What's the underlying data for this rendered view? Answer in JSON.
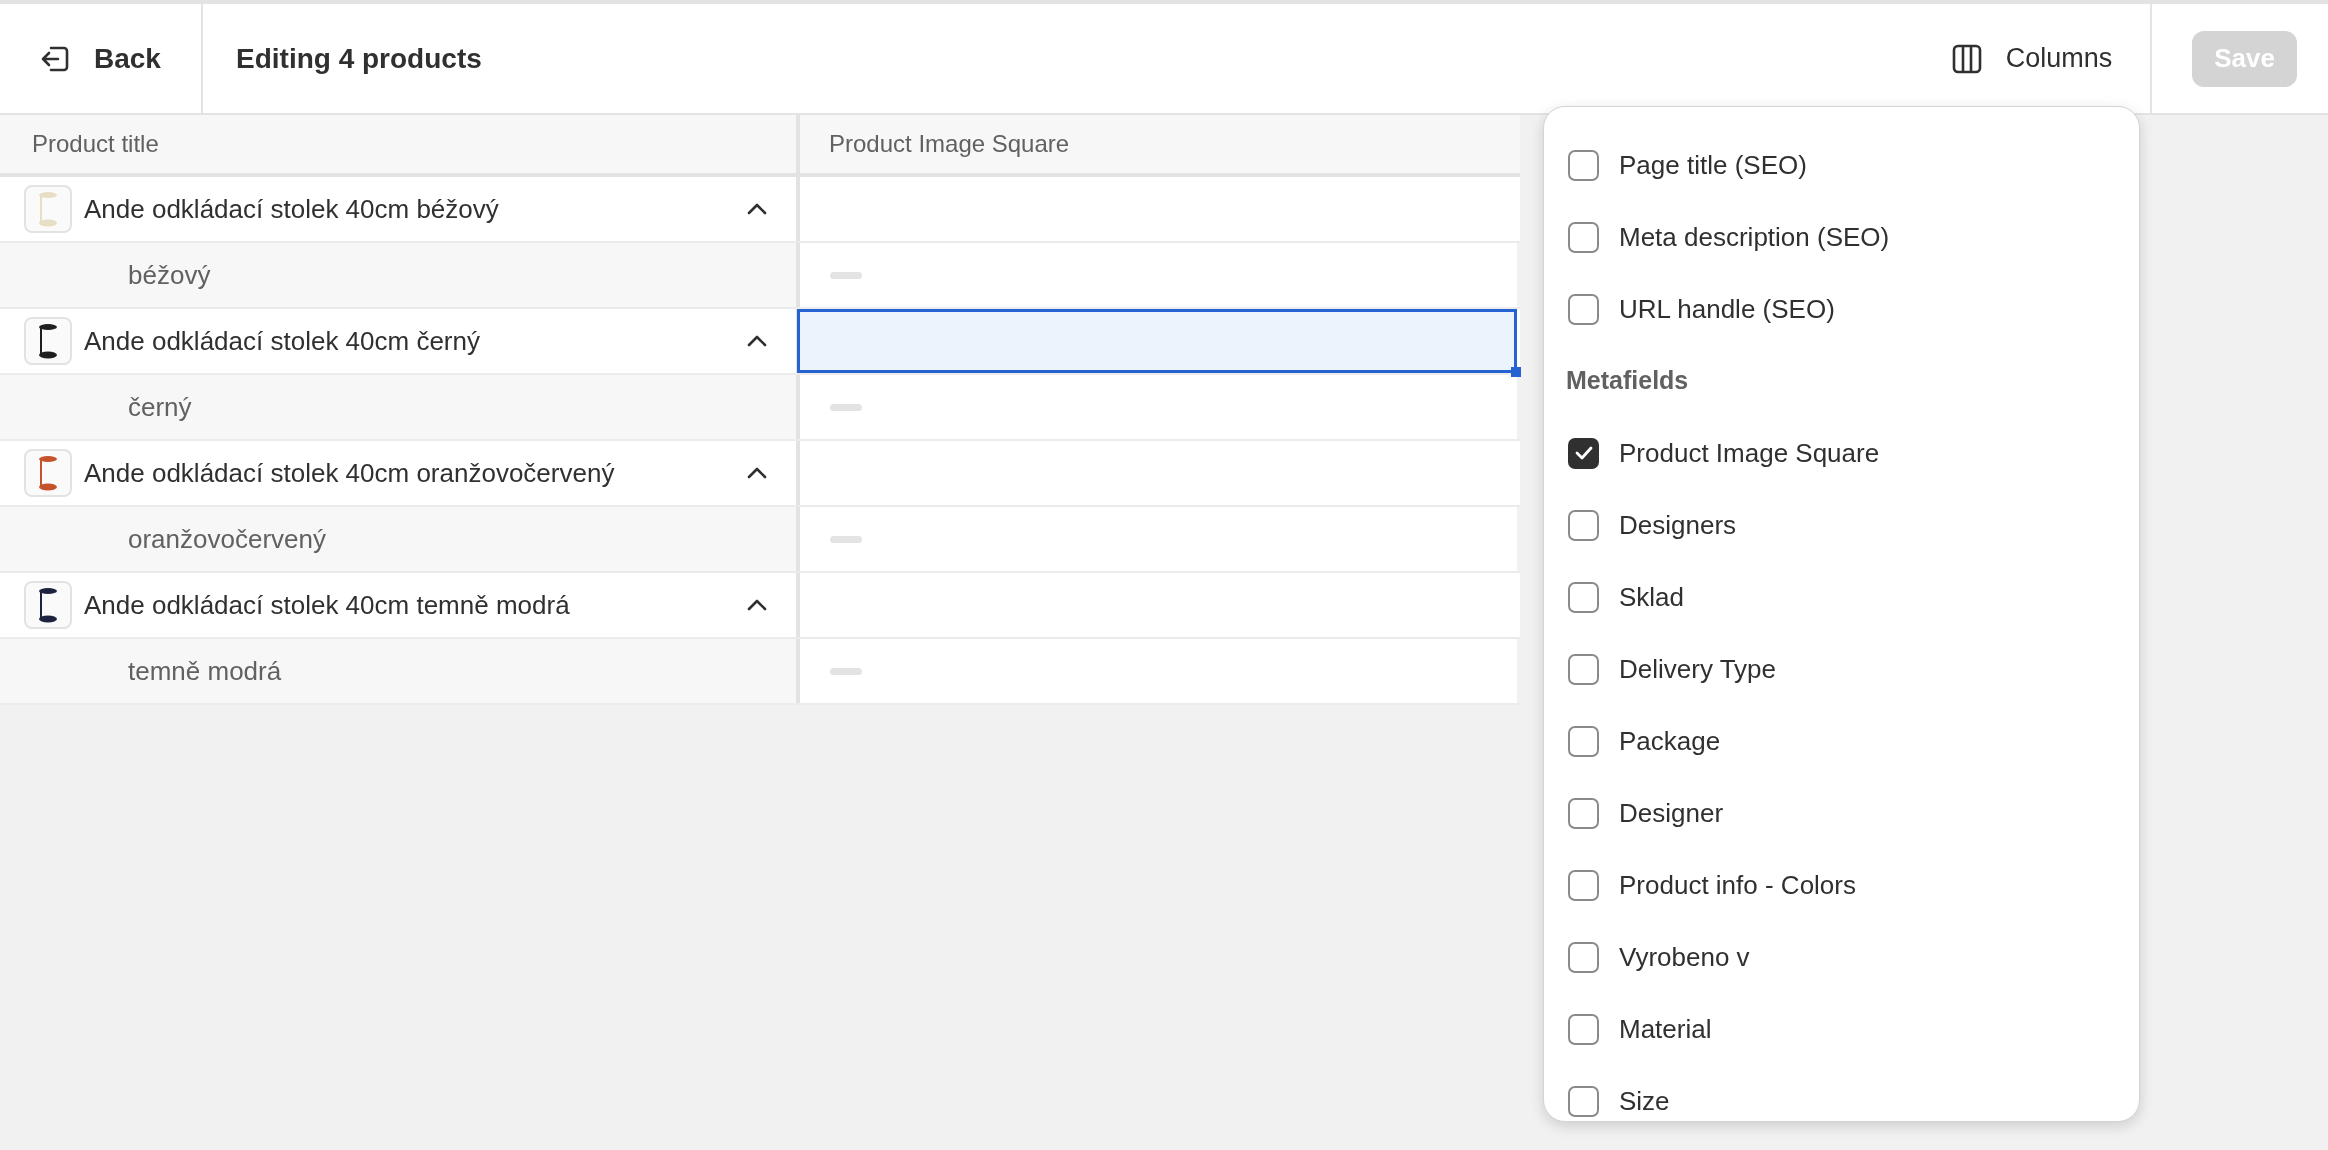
{
  "header": {
    "back_label": "Back",
    "title": "Editing 4 products",
    "columns_label": "Columns",
    "save_label": "Save",
    "save_disabled": true
  },
  "table": {
    "columns": [
      "Product title",
      "Product Image Square"
    ],
    "rows": [
      {
        "title": "Ande odkládací stolek 40cm béžový",
        "color": "#e6dfc4",
        "expanded": true,
        "selected": false,
        "variants": [
          {
            "name": "béžový",
            "selected": false
          }
        ]
      },
      {
        "title": "Ande odkládací stolek 40cm černý",
        "color": "#1f1f1f",
        "expanded": true,
        "selected": true,
        "variants": [
          {
            "name": "černý",
            "selected": false
          }
        ]
      },
      {
        "title": "Ande odkládací stolek 40cm oranžovočervený",
        "color": "#c4532c",
        "expanded": true,
        "selected": false,
        "variants": [
          {
            "name": "oranžovočervený",
            "selected": false
          }
        ]
      },
      {
        "title": "Ande odkládací stolek 40cm temně modrá",
        "color": "#1d2240",
        "expanded": true,
        "selected": false,
        "variants": [
          {
            "name": "temně modrá",
            "selected": false
          }
        ]
      }
    ]
  },
  "columns_menu": {
    "items": [
      {
        "kind": "option",
        "label": "Page title (SEO)",
        "checked": false
      },
      {
        "kind": "option",
        "label": "Meta description (SEO)",
        "checked": false
      },
      {
        "kind": "option",
        "label": "URL handle (SEO)",
        "checked": false
      },
      {
        "kind": "heading",
        "label": "Metafields"
      },
      {
        "kind": "option",
        "label": "Product Image Square",
        "checked": true
      },
      {
        "kind": "option",
        "label": "Designers",
        "checked": false
      },
      {
        "kind": "option",
        "label": "Sklad",
        "checked": false
      },
      {
        "kind": "option",
        "label": "Delivery Type",
        "checked": false
      },
      {
        "kind": "option",
        "label": "Package",
        "checked": false
      },
      {
        "kind": "option",
        "label": "Designer",
        "checked": false
      },
      {
        "kind": "option",
        "label": "Product info - Colors",
        "checked": false
      },
      {
        "kind": "option",
        "label": "Vyrobeno v",
        "checked": false
      },
      {
        "kind": "option",
        "label": "Material",
        "checked": false
      },
      {
        "kind": "option",
        "label": "Size",
        "checked": false
      }
    ]
  }
}
